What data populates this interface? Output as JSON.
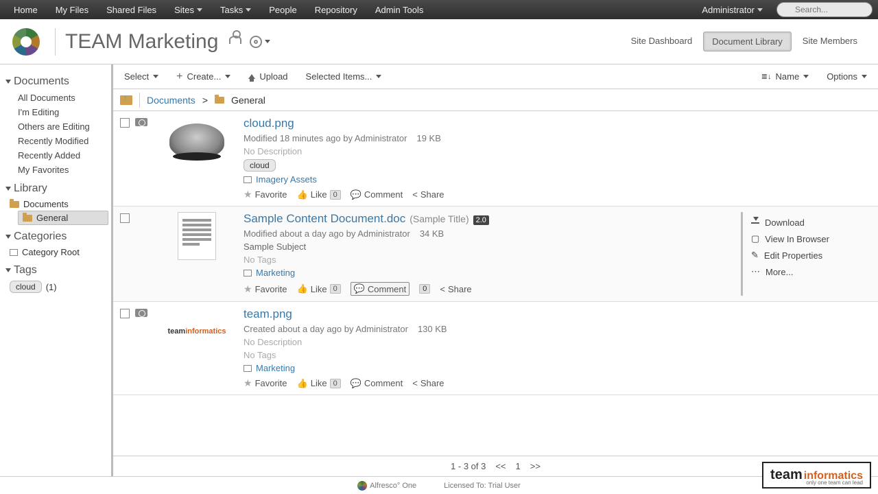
{
  "topnav": {
    "items": [
      "Home",
      "My Files",
      "Shared Files",
      "Sites",
      "Tasks",
      "People",
      "Repository",
      "Admin Tools"
    ],
    "dropdown_items": [
      "Sites",
      "Tasks"
    ],
    "user": "Administrator",
    "search_placeholder": "Search..."
  },
  "site": {
    "title": "TEAM Marketing",
    "tabs": [
      {
        "label": "Site Dashboard",
        "active": false
      },
      {
        "label": "Document Library",
        "active": true
      },
      {
        "label": "Site Members",
        "active": false
      }
    ]
  },
  "sidebar": {
    "documents": {
      "title": "Documents",
      "links": [
        "All Documents",
        "I'm Editing",
        "Others are Editing",
        "Recently Modified",
        "Recently Added",
        "My Favorites"
      ]
    },
    "library": {
      "title": "Library",
      "root": "Documents",
      "children": [
        "General"
      ],
      "selected": "General"
    },
    "categories": {
      "title": "Categories",
      "root": "Category Root"
    },
    "tags": {
      "title": "Tags",
      "items": [
        {
          "name": "cloud",
          "count": 1
        }
      ]
    }
  },
  "toolbar": {
    "select": "Select",
    "create": "Create...",
    "upload": "Upload",
    "selected": "Selected Items...",
    "sort": "Name",
    "options": "Options"
  },
  "breadcrumb": {
    "root": "Documents",
    "current": "General"
  },
  "docs": [
    {
      "title": "cloud.png",
      "modified": "Modified 18 minutes ago by Administrator",
      "size": "19 KB",
      "description": "No Description",
      "desc_placeholder": true,
      "tags": [
        "cloud"
      ],
      "category": "Imagery Assets",
      "actions": {
        "fav": "Favorite",
        "like": "Like",
        "like_n": "0",
        "comment": "Comment",
        "share": "Share"
      },
      "thumb": "cloud",
      "has_cam": true
    },
    {
      "title": "Sample Content Document.doc",
      "title_sub": "(Sample Title)",
      "version": "2.0",
      "modified": "Modified about a day ago by Administrator",
      "size": "34 KB",
      "description": "Sample Subject",
      "desc_placeholder": false,
      "tags": [],
      "category": "Marketing",
      "actions": {
        "fav": "Favorite",
        "like": "Like",
        "like_n": "0",
        "comment": "Comment",
        "comment_n": "0",
        "share": "Share"
      },
      "thumb": "doc",
      "has_cam": false,
      "hovered": true,
      "row_actions": [
        "Download",
        "View In Browser",
        "Edit Properties",
        "More..."
      ]
    },
    {
      "title": "team.png",
      "modified": "Created about a day ago by Administrator",
      "size": "130 KB",
      "description": "No Description",
      "desc_placeholder": true,
      "tags": [],
      "category": "Marketing",
      "actions": {
        "fav": "Favorite",
        "like": "Like",
        "like_n": "0",
        "comment": "Comment",
        "share": "Share"
      },
      "thumb": "team",
      "has_cam": true
    }
  ],
  "pager": {
    "summary": "1 - 3 of 3",
    "prev": "<<",
    "page": "1",
    "next": ">>"
  },
  "footer": {
    "product": "Alfresco° One",
    "license": "Licensed To: Trial User"
  },
  "badge": {
    "t1": "team",
    "t2": "informatics",
    "sub": "only one team can lead"
  }
}
